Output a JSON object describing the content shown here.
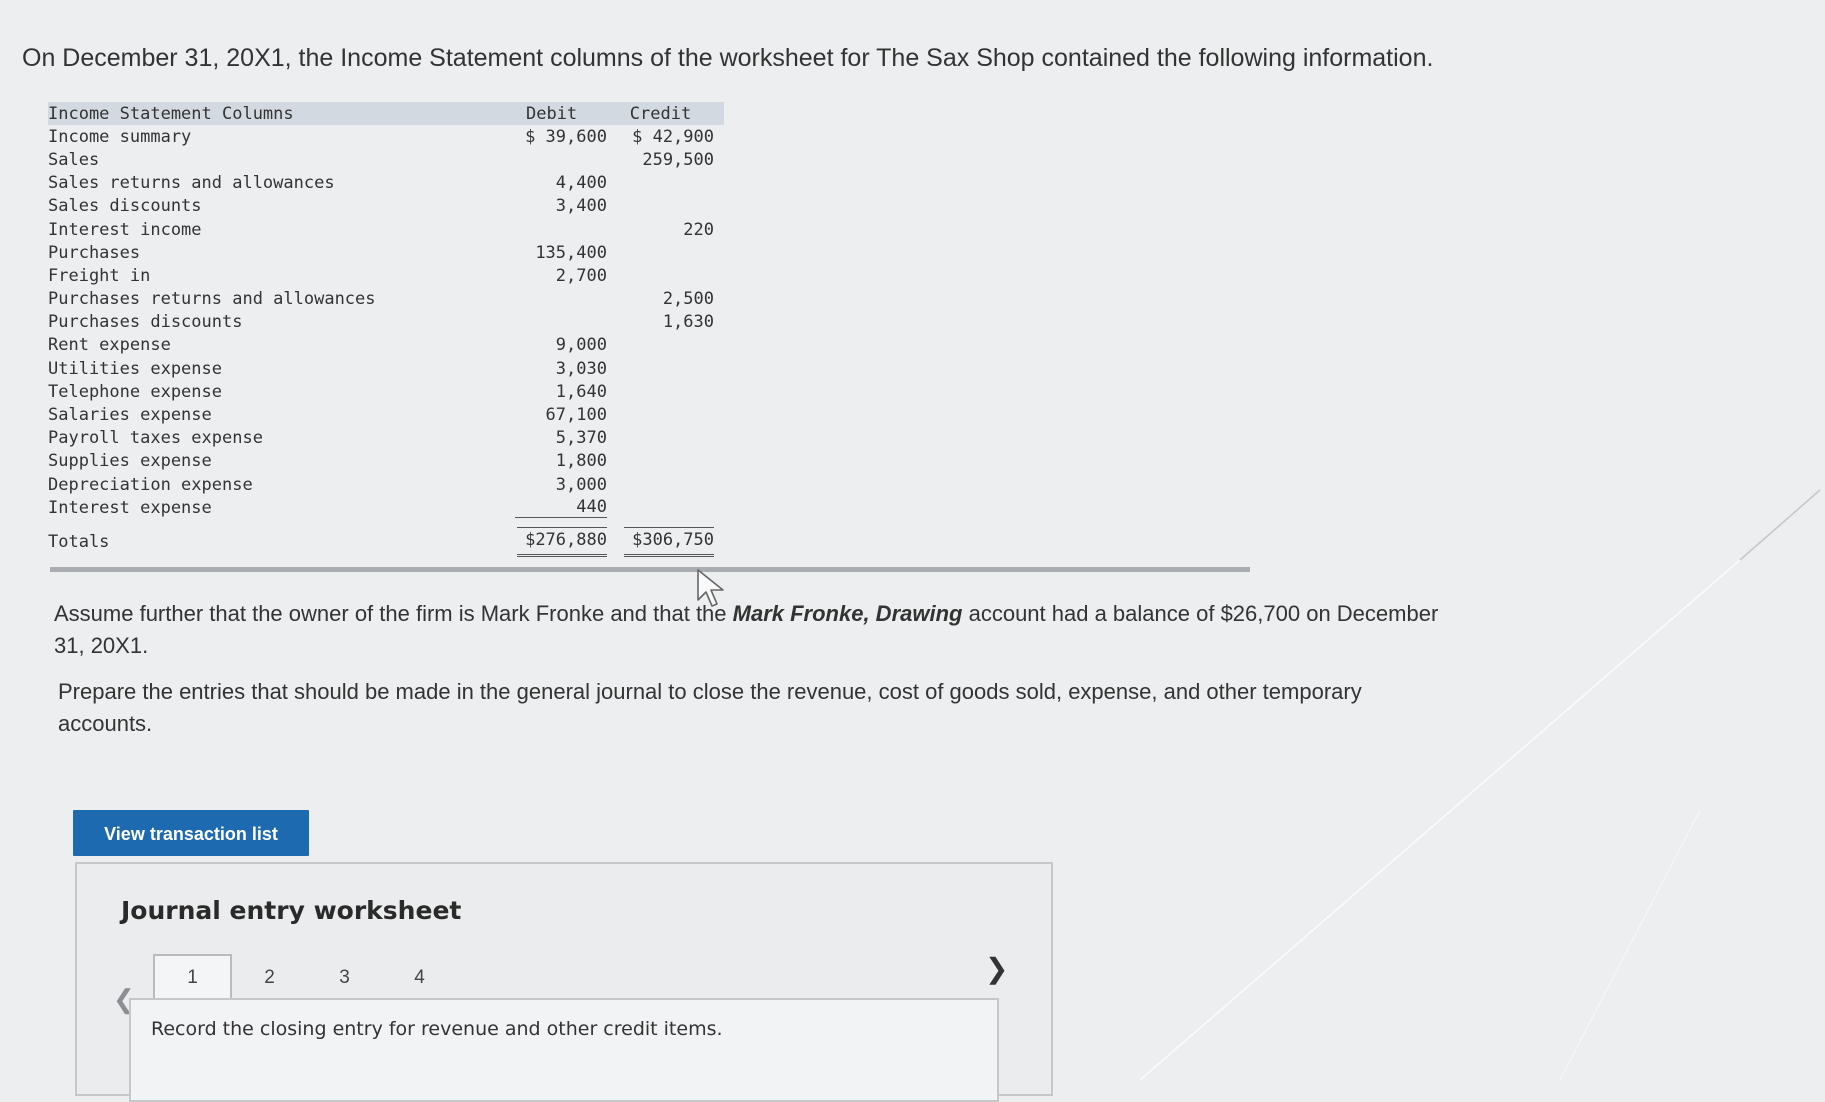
{
  "intro_text": "On December 31, 20X1, the Income Statement columns of the worksheet for The Sax Shop contained the following information.",
  "table": {
    "headers": {
      "label": "Income Statement Columns",
      "debit": "Debit",
      "credit": "Credit"
    },
    "rows": [
      {
        "label": "Income summary",
        "debit": "$ 39,600",
        "credit": "$ 42,900"
      },
      {
        "label": "Sales",
        "debit": "",
        "credit": "259,500"
      },
      {
        "label": "Sales returns and allowances",
        "debit": "4,400",
        "credit": ""
      },
      {
        "label": "Sales discounts",
        "debit": "3,400",
        "credit": ""
      },
      {
        "label": "Interest income",
        "debit": "",
        "credit": "220"
      },
      {
        "label": "Purchases",
        "debit": "135,400",
        "credit": ""
      },
      {
        "label": "Freight in",
        "debit": "2,700",
        "credit": ""
      },
      {
        "label": "Purchases returns and allowances",
        "debit": "",
        "credit": "2,500"
      },
      {
        "label": "Purchases discounts",
        "debit": "",
        "credit": "1,630"
      },
      {
        "label": "Rent expense",
        "debit": "9,000",
        "credit": ""
      },
      {
        "label": "Utilities expense",
        "debit": "3,030",
        "credit": ""
      },
      {
        "label": "Telephone expense",
        "debit": "1,640",
        "credit": ""
      },
      {
        "label": "Salaries expense",
        "debit": "67,100",
        "credit": ""
      },
      {
        "label": "Payroll taxes expense",
        "debit": "5,370",
        "credit": ""
      },
      {
        "label": "Supplies expense",
        "debit": "1,800",
        "credit": ""
      },
      {
        "label": "Depreciation expense",
        "debit": "3,000",
        "credit": ""
      },
      {
        "label": "Interest expense",
        "debit": "440",
        "credit": ""
      }
    ],
    "totals": {
      "label": "Totals",
      "debit": "$276,880",
      "credit": "$306,750"
    }
  },
  "assume_text": {
    "before": "Assume further that the owner of the firm is Mark Fronke and that the ",
    "account": "Mark Fronke, Drawing",
    "after": " account had a balance of $26,700 on December 31, 20X1."
  },
  "prepare_text": "Prepare the entries that should be made in the general journal to close the revenue, cost of goods sold, expense, and other temporary accounts.",
  "view_button_label": "View transaction list",
  "worksheet": {
    "title": "Journal entry worksheet",
    "pages": [
      "1",
      "2",
      "3",
      "4"
    ],
    "active_page": "1",
    "prompt": "Record the closing entry for revenue and other credit items."
  },
  "icons": {
    "prev": "chevron-left-icon",
    "next": "chevron-right-icon",
    "cursor": "mouse-pointer-icon"
  },
  "colors": {
    "button": "#1e6ab1",
    "header_band": "#d2d9e0",
    "page_bg": "#eceeef"
  }
}
